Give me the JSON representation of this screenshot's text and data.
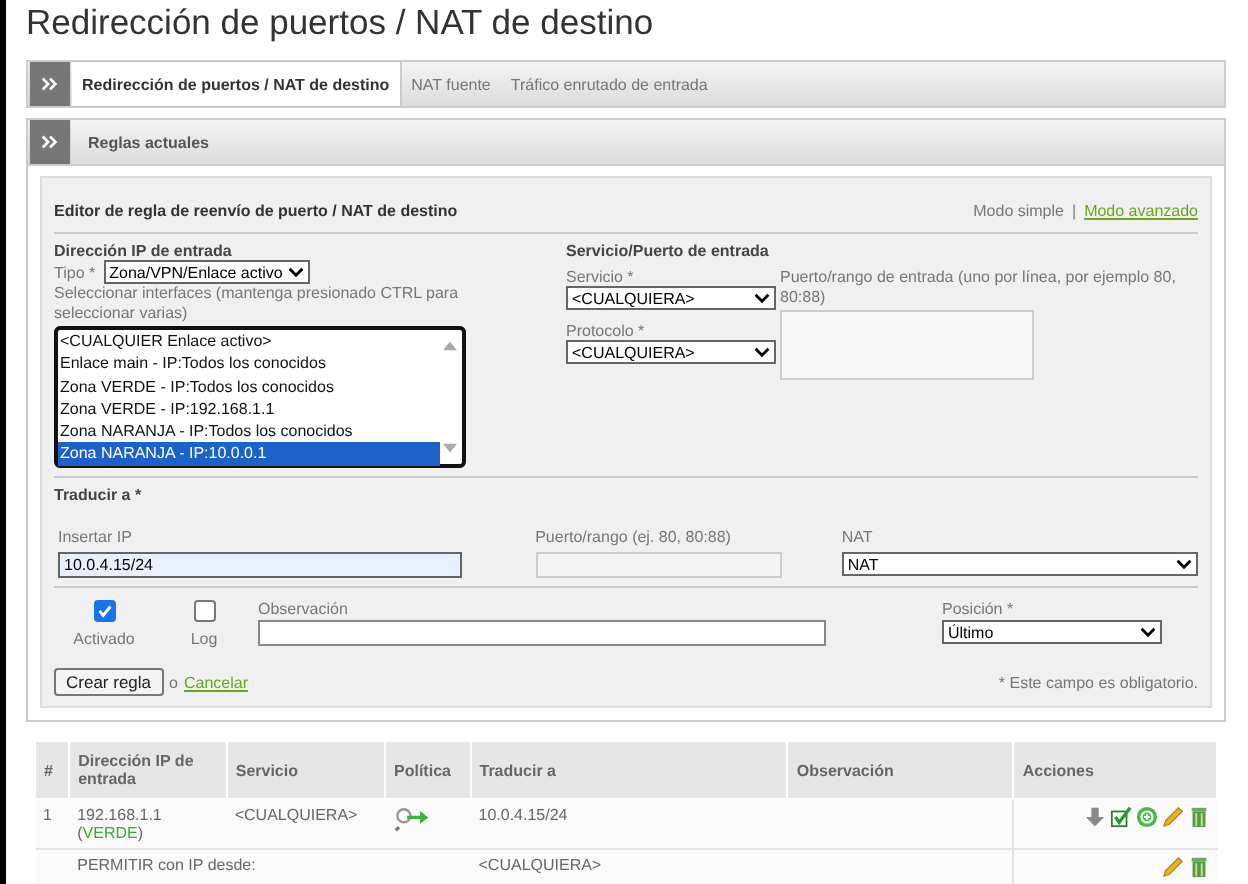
{
  "title": "Redirección de puertos / NAT de destino",
  "tabs": [
    {
      "label": "Redirección de puertos / NAT de destino",
      "selected": true
    },
    {
      "label": "NAT fuente",
      "selected": false
    },
    {
      "label": "Tráfico enrutado de entrada",
      "selected": false
    }
  ],
  "section": {
    "title": "Reglas actuales"
  },
  "editor": {
    "title": "Editor de regla de reenvío de puerto / NAT de destino",
    "mode_simple": "Modo simple",
    "mode_separator": "|",
    "mode_advanced": "Modo avanzado",
    "source": {
      "heading": "Dirección IP de entrada",
      "type_label": "Tipo *",
      "type_value": "Zona/VPN/Enlace activo",
      "hint": "Seleccionar interfaces (mantenga presionado CTRL para seleccionar varias)",
      "options": [
        {
          "label": "<CUALQUIER Enlace activo>",
          "selected": false
        },
        {
          "label": "Enlace main - IP:Todos los conocidos",
          "selected": false
        },
        {
          "label": "Zona VERDE - IP:Todos los conocidos",
          "selected": false
        },
        {
          "label": "Zona VERDE - IP:192.168.1.1",
          "selected": false
        },
        {
          "label": "Zona NARANJA - IP:Todos los conocidos",
          "selected": false
        },
        {
          "label": "Zona NARANJA - IP:10.0.0.1",
          "selected": true
        }
      ]
    },
    "service": {
      "heading": "Servicio/Puerto de entrada",
      "service_label": "Servicio *",
      "service_value": "<CUALQUIERA>",
      "protocol_label": "Protocolo *",
      "protocol_value": "<CUALQUIERA>",
      "port_label": "Puerto/rango de entrada (uno por línea, por ejemplo 80, 80:88)"
    },
    "translate": {
      "heading": "Traducir a *",
      "ip_label": "Insertar IP",
      "ip_value": "10.0.4.15/24",
      "port_label": "Puerto/rango (ej. 80, 80:88)",
      "nat_label": "NAT",
      "nat_value": "NAT"
    },
    "enabled": {
      "label": "Activado",
      "checked": true
    },
    "log": {
      "label": "Log",
      "checked": false
    },
    "remark_label": "Observación",
    "position_label": "Posición *",
    "position_value": "Último",
    "create_button": "Crear regla",
    "or": "o",
    "cancel": "Cancelar",
    "required_note": "* Este campo es obligatorio."
  },
  "table": {
    "columns": [
      "#",
      "Dirección IP de entrada",
      "Servicio",
      "Política",
      "Traducir a",
      "Observación",
      "Acciones"
    ],
    "rows": [
      {
        "kind": "rule",
        "number": "1",
        "ip": "192.168.1.1",
        "zone_open": "(",
        "zone": "VERDE",
        "zone_close": ")",
        "service": "<CUALQUIERA>",
        "translate": "10.0.4.15/24"
      },
      {
        "kind": "allow",
        "label": "PERMITIR con IP desde:",
        "translate": "<CUALQUIERA>"
      }
    ]
  }
}
